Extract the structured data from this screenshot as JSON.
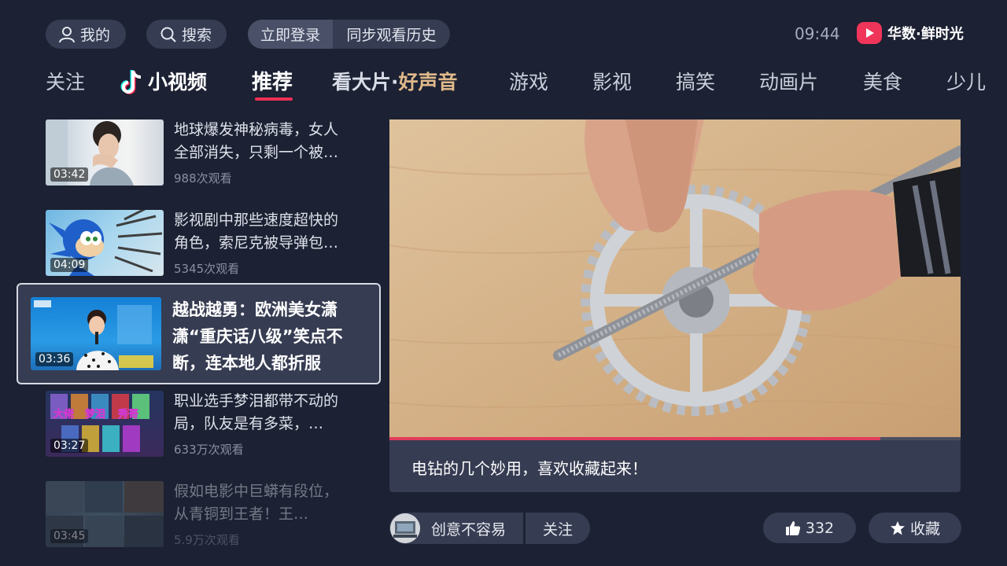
{
  "header": {
    "me_label": "我的",
    "search_label": "搜索",
    "login_label": "立即登录",
    "sync_label": "同步观看历史",
    "clock": "09:44",
    "brand_name": "华数·鲜时光"
  },
  "nav": {
    "items": [
      {
        "label": "关注"
      },
      {
        "label": "小视频"
      },
      {
        "label": "推荐",
        "active": true
      },
      {
        "label_main": "看大片·",
        "label_accent": "好声音"
      },
      {
        "label": "游戏"
      },
      {
        "label": "影视"
      },
      {
        "label": "搞笑"
      },
      {
        "label": "动画片"
      },
      {
        "label": "美食"
      },
      {
        "label": "少儿"
      }
    ]
  },
  "video_list": [
    {
      "title": "地球爆发神秘病毒，女人全部消失，只剩一个被…",
      "views": "988次观看",
      "duration": "03:42"
    },
    {
      "title": "影视剧中那些速度超快的角色，索尼克被导弹包…",
      "views": "5345次观看",
      "duration": "04:09"
    },
    {
      "title": "越战越勇：欧洲美女潇潇“重庆话八级”笑点不断，连本地人都折服",
      "views": "",
      "duration": "03:36",
      "focused": true
    },
    {
      "title": "职业选手梦泪都带不动的局，队友是有多菜，…",
      "views": "633万次观看",
      "duration": "03:27"
    },
    {
      "title": "假如电影中巨蟒有段位，从青铜到王者！王…",
      "views": "5.9万次观看",
      "duration": "03:45"
    }
  ],
  "player": {
    "caption": "电钻的几个妙用，喜欢收藏起来！",
    "progress": 0.86
  },
  "author": {
    "name": "创意不容易",
    "follow_label": "关注"
  },
  "actions": {
    "like_count": "332",
    "favorite_label": "收藏"
  },
  "colors": {
    "background": "#1c2133",
    "accent": "#ef2f57",
    "gold": "#e0b98a",
    "panel": "#363c52"
  }
}
